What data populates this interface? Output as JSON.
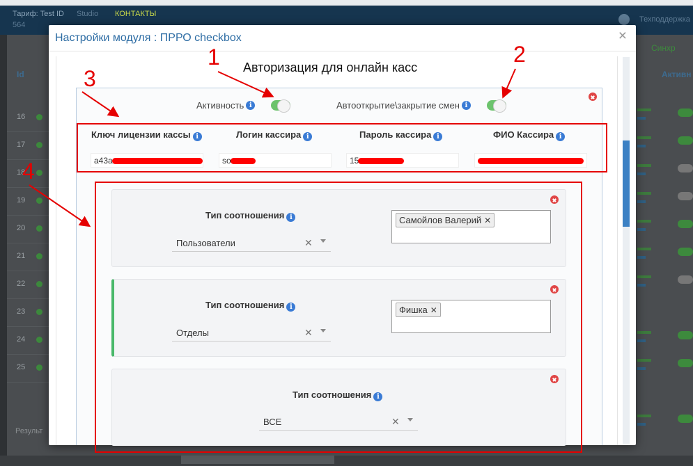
{
  "background": {
    "tariff": "Тариф: Test ID",
    "tab1": "Studio",
    "tab2": "КОНТАКТЫ",
    "sub": "564",
    "help": "Техподдержка",
    "sync": "Синхр",
    "col_id": "Id",
    "col_active": "Активн",
    "row_numbers": [
      "16",
      "17",
      "18",
      "19",
      "20",
      "21",
      "22",
      "23",
      "24",
      "25"
    ],
    "footer_text": "Результ"
  },
  "modal": {
    "title": "Настройки модуля : ПРРО checkbox",
    "close": "×",
    "section_title": "Авторизация для онлайн касс",
    "toggles": [
      {
        "label": "Активность",
        "on": true
      },
      {
        "label": "Автооткрытие\\закрытие смен",
        "on": true
      }
    ],
    "credentials": [
      {
        "label": "Ключ лицензии кассы",
        "value": "a43a"
      },
      {
        "label": "Логин кассира",
        "value": "so"
      },
      {
        "label": "Пароль кассира",
        "value": "15"
      },
      {
        "label": "ФИО Кассира",
        "value": ""
      }
    ],
    "cards": [
      {
        "label": "Тип соотношения",
        "select_value": "Пользователи",
        "tag": "Самойлов Валерий"
      },
      {
        "label": "Тип соотношения",
        "select_value": "Отделы",
        "tag": "Фишка"
      },
      {
        "label": "Тип соотношения",
        "select_value": "ВСЕ"
      }
    ]
  },
  "annotations": {
    "labels": [
      "1",
      "2",
      "3",
      "4"
    ],
    "color": "#e50000"
  },
  "colors": {
    "accent": "#2e6da4",
    "toggle_on": "#6cc36c",
    "info": "#3a7bd5",
    "remove": "#e04646",
    "card_accent": "#49b86a"
  }
}
